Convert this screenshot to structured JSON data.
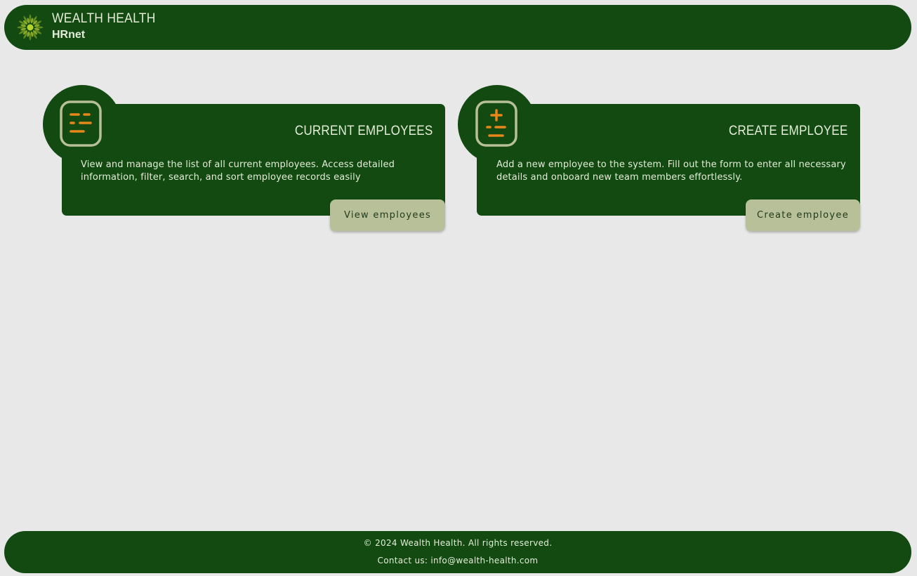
{
  "header": {
    "logo_icon": "sunburst-logo-icon",
    "title": "WEALTH HEALTH",
    "subtitle": "HRnet"
  },
  "cards": [
    {
      "icon": "list-icon",
      "title": "CURRENT EMPLOYEES",
      "description": "View and manage the list of all current employees. Access detailed information, filter, search, and sort employee records easily",
      "button_label": "View employees"
    },
    {
      "icon": "add-list-icon",
      "title": "CREATE EMPLOYEE",
      "description": "Add a new employee to the system. Fill out the form to enter all necessary details and onboard new team members effortlessly.",
      "button_label": "Create employee"
    }
  ],
  "footer": {
    "copyright": "© 2024 Wealth Health. All rights reserved.",
    "contact": "Contact us: info@wealth-health.com"
  },
  "colors": {
    "primary": "#124a12",
    "accent": "#e8861a",
    "button": "#b8c09a",
    "background": "#e8e8e8",
    "text_light": "#e4ecd8"
  }
}
